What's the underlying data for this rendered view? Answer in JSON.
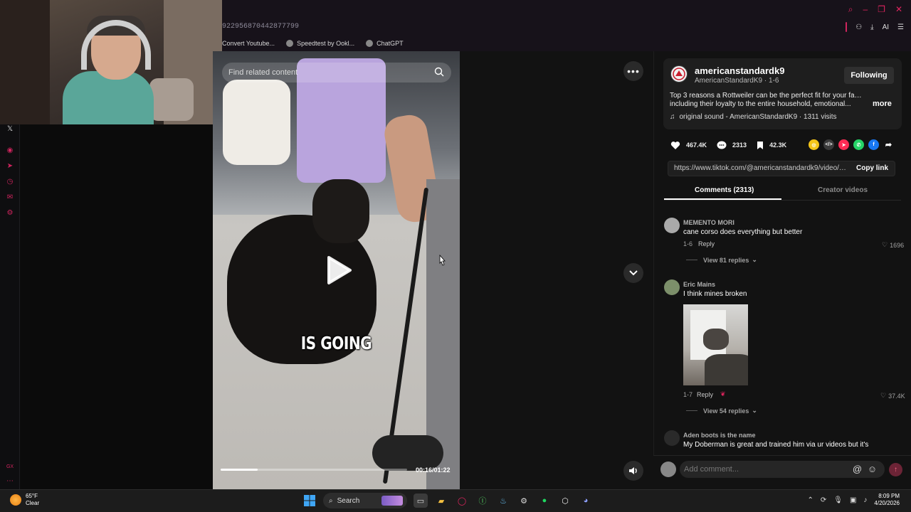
{
  "browser": {
    "url_fragment": "922956870442877799",
    "bookmarks": [
      {
        "label": "Convert Youtube..."
      },
      {
        "label": "Speedtest by Ookl..."
      },
      {
        "label": "ChatGPT"
      }
    ],
    "ai_label": "AI"
  },
  "sidebar": {
    "icons": [
      "x-icon",
      "circle-icon",
      "send-icon",
      "history-icon",
      "chat-icon",
      "settings-icon"
    ],
    "bottom_label": "GX"
  },
  "video": {
    "search_placeholder": "Find related content",
    "caption": "IS GOING",
    "current_time": "00:16",
    "duration": "01:22",
    "time_display": "00:16/01:22",
    "progress": 0.2
  },
  "author": {
    "username": "americanstandardk9",
    "display_name": "AmericanStandardK9",
    "date": "1-6",
    "sub_line": "AmericanStandardK9 · 1-6",
    "follow_label": "Following",
    "description_line1": "Top 3 reasons a Rottweiler can be the perfect fit for your family,",
    "description_line2": "including their loyalty to the entire household, emotional...",
    "more_label": "more",
    "sound": "original sound - AmericanStandardK9 · 1311 visits"
  },
  "stats": {
    "likes": "467.4K",
    "comments": "2313",
    "saves": "42.3K"
  },
  "share": {
    "link": "https://www.tiktok.com/@americanstandardk9/video/7...",
    "copy_label": "Copy link",
    "colors": [
      "#f5c518",
      "#3a3a3a",
      "#fe2c55",
      "#25d366",
      "#1877f2"
    ]
  },
  "tabs": [
    {
      "label": "Comments (2313)",
      "active": true
    },
    {
      "label": "Creator videos",
      "active": false
    }
  ],
  "comments": [
    {
      "user": "MEMENTO MORI",
      "text": "cane corso does everything but better",
      "date": "1-6",
      "reply_label": "Reply",
      "likes": "1696",
      "view_replies": "View 81 replies"
    },
    {
      "user": "Eric Mains",
      "text": "I think mines broken",
      "date": "1-7",
      "reply_label": "Reply",
      "likes": "37.4K",
      "view_replies": "View 54 replies"
    },
    {
      "user": "Aden boots is the name",
      "text": "My Doberman is great and trained him via ur videos but it's"
    }
  ],
  "add_comment": {
    "placeholder": "Add comment..."
  },
  "taskbar": {
    "weather_temp": "65°F",
    "weather_desc": "Clear",
    "search_label": "Search",
    "time": "8:09 PM",
    "date": "4/20/2026"
  }
}
